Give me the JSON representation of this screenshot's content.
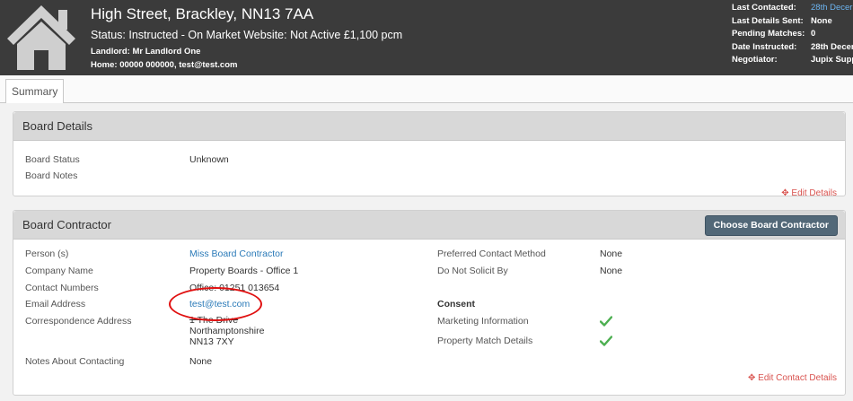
{
  "header": {
    "title": "High Street, Brackley, NN13 7AA",
    "status_line": "Status: Instructed - On Market   Website: Not Active   £1,100 pcm",
    "landlord": "Landlord: Mr Landlord One",
    "home": "Home: 00000 000000, test@test.com",
    "meta": [
      {
        "label": "Last Contacted:",
        "value": "28th Decer"
      },
      {
        "label": "Last Details Sent:",
        "value": "None"
      },
      {
        "label": "Pending Matches:",
        "value": "0"
      },
      {
        "label": "Date Instructed:",
        "value": "28th Decer"
      },
      {
        "label": "Negotiator:",
        "value": "Jupix Supp"
      }
    ]
  },
  "tabs": [
    "Summary"
  ],
  "board_details": {
    "title": "Board Details",
    "status_label": "Board Status",
    "status_value": "Unknown",
    "notes_label": "Board Notes",
    "edit_label": "Edit Details"
  },
  "board_contractor": {
    "title": "Board Contractor",
    "choose_button": "Choose Board Contractor",
    "person_label": "Person (s)",
    "person_value": "Miss Board Contractor",
    "company_label": "Company Name",
    "company_value": "Property Boards - Office 1",
    "numbers_label": "Contact Numbers",
    "numbers_value": "Office: 01251 013654",
    "email_label": "Email Address",
    "email_value": "test@test.com",
    "address_label": "Correspondence Address",
    "address_lines": [
      "1 The Drive",
      "Northamptonshire",
      "NN13 7XY"
    ],
    "notes_label": "Notes About Contacting",
    "notes_value": "None",
    "pref_method_label": "Preferred Contact Method",
    "pref_method_value": "None",
    "dns_label": "Do Not Solicit By",
    "dns_value": "None",
    "consent_label": "Consent",
    "marketing_label": "Marketing Information",
    "property_match_label": "Property Match Details",
    "edit_label": "Edit Contact Details"
  },
  "colors": {
    "header_bg": "#3b3b3b",
    "link": "#2a7ab8",
    "edit_red": "#d9534f",
    "check_green": "#4caf50",
    "button_bg": "#526878",
    "annotation_red": "#e01010"
  }
}
